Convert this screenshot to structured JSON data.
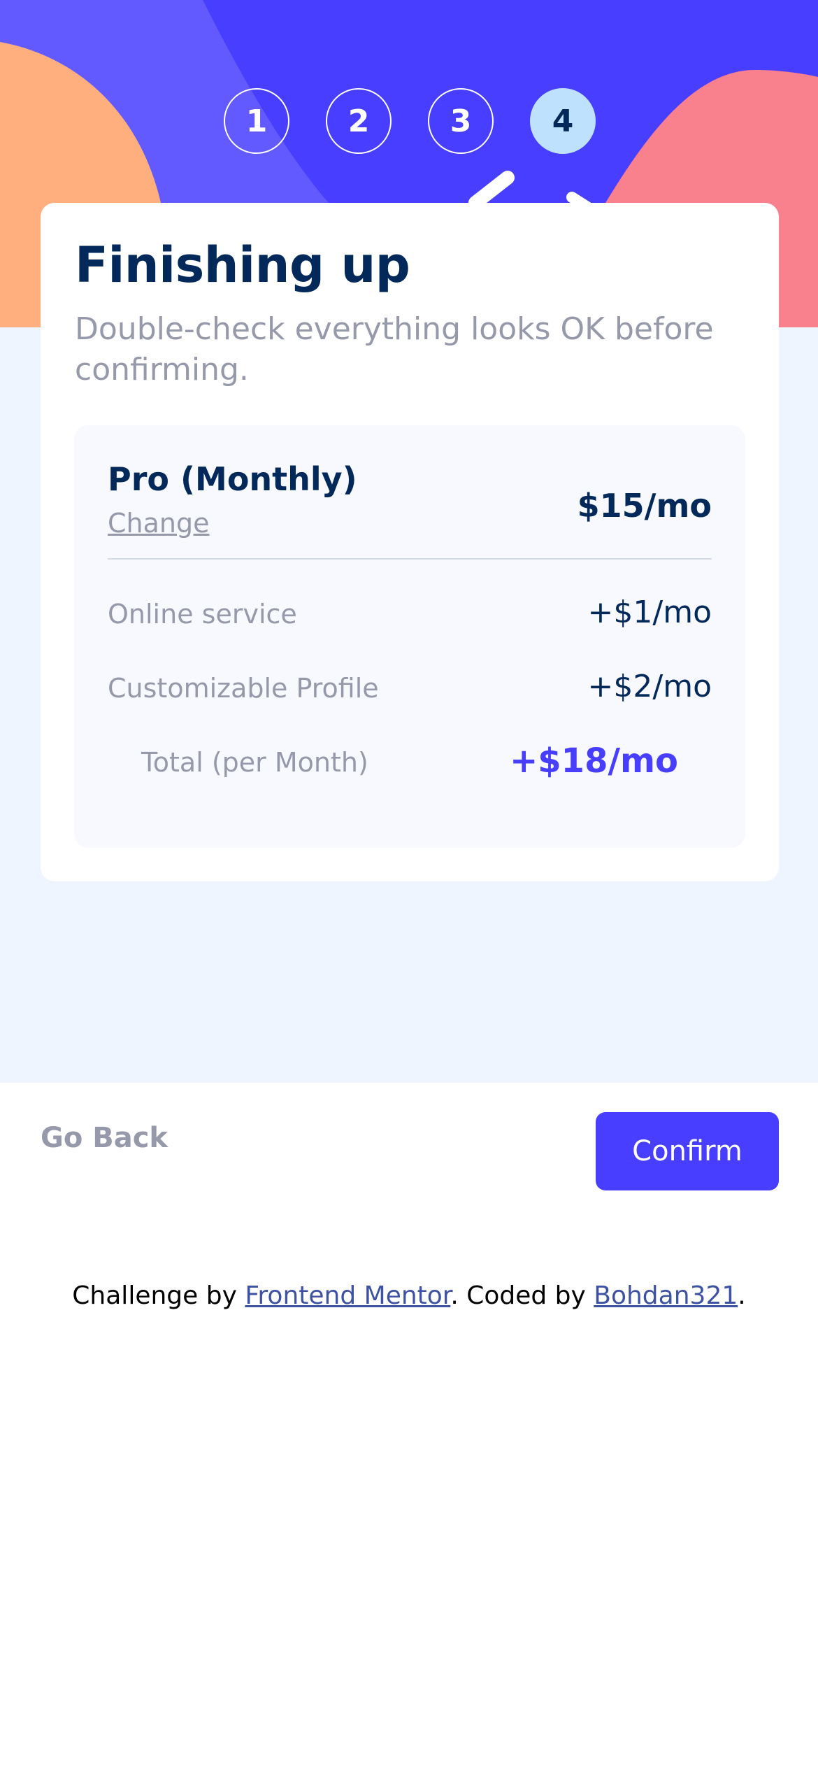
{
  "steps": [
    {
      "number": "1",
      "active": false
    },
    {
      "number": "2",
      "active": false
    },
    {
      "number": "3",
      "active": false
    },
    {
      "number": "4",
      "active": true
    }
  ],
  "card": {
    "title": "Finishing up",
    "subtitle": "Double-check everything looks OK before confirming."
  },
  "summary": {
    "plan_name": "Pro (Monthly)",
    "change_label": "Change",
    "plan_price": "$15/mo",
    "addons": [
      {
        "name": "Online service",
        "price": "+$1/mo"
      },
      {
        "name": "Customizable Profile",
        "price": "+$2/mo"
      }
    ],
    "total_label": "Total (per Month)",
    "total_price": "+$18/mo"
  },
  "nav": {
    "back_label": "Go Back",
    "confirm_label": "Confirm"
  },
  "attribution": {
    "prefix": "Challenge by ",
    "link1": "Frontend Mentor",
    "middle": ". Coded by ",
    "link2": "Bohdan321",
    "suffix": "."
  },
  "colors": {
    "marine_blue": "#022959",
    "purplish_blue": "#483eff",
    "grey": "#9699aa",
    "light_blue": "#bee2fd",
    "background": "#eff5ff",
    "orange": "#ffaf7e",
    "pink": "#f9818e"
  }
}
